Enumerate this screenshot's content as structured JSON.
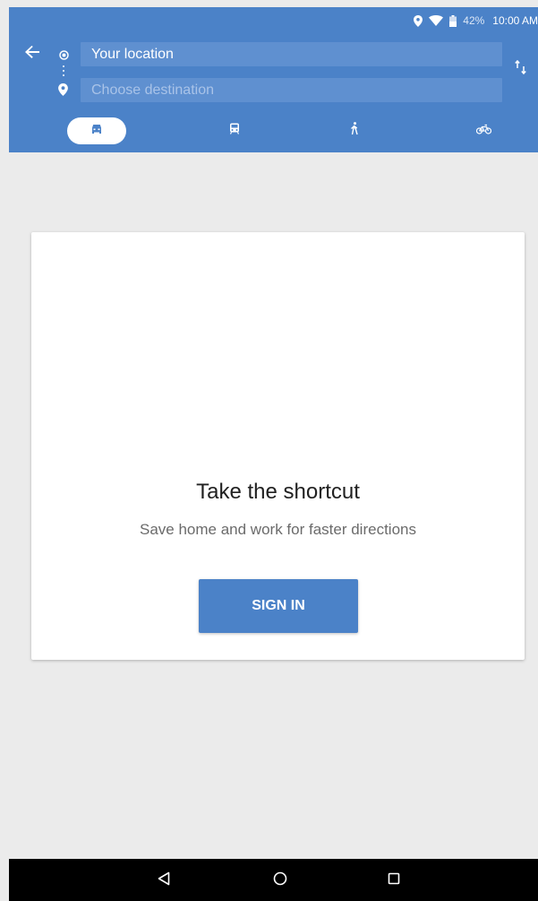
{
  "status_bar": {
    "battery_percent": "42%",
    "time": "10:00 AM",
    "icons": [
      "location-pin-icon",
      "wifi-icon",
      "battery-icon"
    ]
  },
  "directions": {
    "back_icon": "arrow-left-icon",
    "origin_value": "Your location",
    "destination_placeholder": "Choose destination",
    "swap_icon": "swap-vertical-icon"
  },
  "modes": [
    {
      "name": "drive",
      "icon": "car-icon",
      "selected": true
    },
    {
      "name": "transit",
      "icon": "train-icon",
      "selected": false
    },
    {
      "name": "walk",
      "icon": "walk-icon",
      "selected": false
    },
    {
      "name": "bike",
      "icon": "bike-icon",
      "selected": false
    }
  ],
  "card": {
    "title": "Take the shortcut",
    "subtitle": "Save home and work for faster directions",
    "button_label": "SIGN IN"
  },
  "nav_bar": {
    "icons": [
      "back-triangle-icon",
      "home-circle-icon",
      "recents-square-icon"
    ]
  },
  "colors": {
    "accent": "#4b82c8",
    "field_bg": "#5f90d0",
    "page_bg": "#ebebeb"
  }
}
